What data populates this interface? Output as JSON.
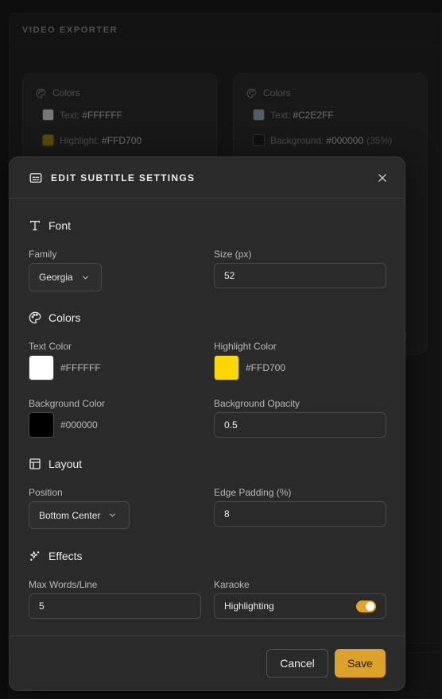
{
  "background_app": {
    "title": "VIDEO EXPORTER",
    "cards": [
      {
        "heading": "Colors",
        "rows": [
          {
            "label": "Text:",
            "value": "#FFFFFF",
            "extra": "",
            "swatch": "#b8b8b8"
          },
          {
            "label": "Highlight:",
            "value": "#FFD700",
            "extra": "",
            "swatch": "#8a7208"
          }
        ]
      },
      {
        "heading": "Colors",
        "rows": [
          {
            "label": "Text:",
            "value": "#C2E2FF",
            "extra": "",
            "swatch": "#7d8fa0"
          },
          {
            "label": "Background:",
            "value": "#000000",
            "extra": "(35%)",
            "swatch": "#1a1a1a"
          }
        ]
      }
    ],
    "ghost_text": "t"
  },
  "modal": {
    "title": "EDIT SUBTITLE SETTINGS",
    "font": {
      "heading": "Font",
      "family_label": "Family",
      "family_value": "Georgia",
      "size_label": "Size (px)",
      "size_value": "52"
    },
    "colors": {
      "heading": "Colors",
      "text_color_label": "Text Color",
      "text_color_value": "#FFFFFF",
      "highlight_color_label": "Highlight Color",
      "highlight_color_value": "#FFD700",
      "background_color_label": "Background Color",
      "background_color_value": "#000000",
      "background_opacity_label": "Background Opacity",
      "background_opacity_value": "0.5"
    },
    "layout": {
      "heading": "Layout",
      "position_label": "Position",
      "position_value": "Bottom Center",
      "edge_padding_label": "Edge Padding (%)",
      "edge_padding_value": "8"
    },
    "effects": {
      "heading": "Effects",
      "max_words_label": "Max Words/Line",
      "max_words_value": "5",
      "karaoke_label": "Karaoke",
      "karaoke_toggle_label": "Highlighting",
      "karaoke_enabled": true
    },
    "footer": {
      "cancel_label": "Cancel",
      "save_label": "Save"
    }
  },
  "colors": {
    "accent": "#DCA22A",
    "modal_bg": "#2A2A2A"
  }
}
